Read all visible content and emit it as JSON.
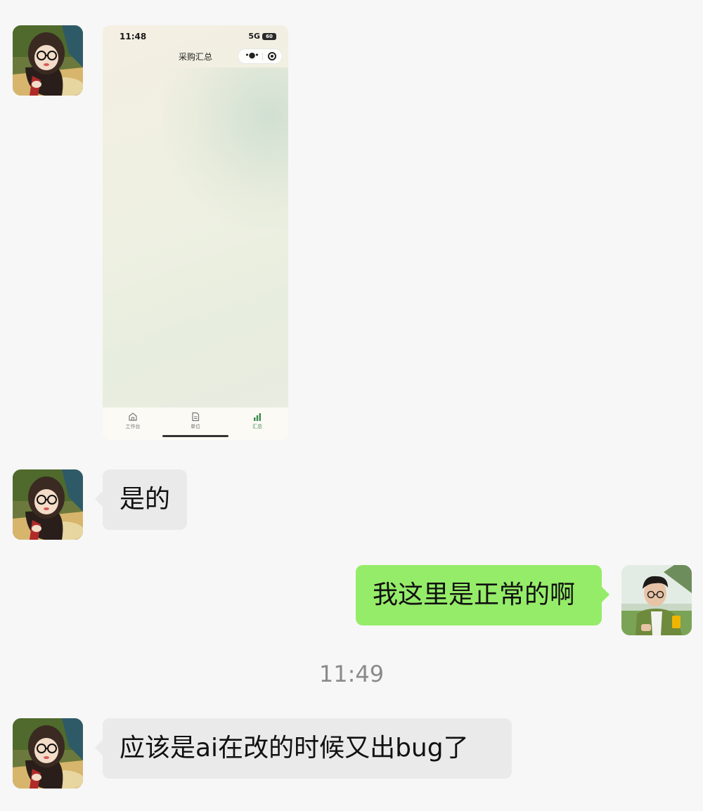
{
  "screenshot": {
    "status_time": "11:48",
    "network": "5G",
    "battery": "60",
    "nav_title": "采购汇总",
    "tabs": [
      {
        "label": "工作台",
        "icon": "home-icon",
        "active": false
      },
      {
        "label": "单位",
        "icon": "document-icon",
        "active": false
      },
      {
        "label": "汇总",
        "icon": "bar-chart-icon",
        "active": true
      }
    ],
    "colors": {
      "active_tab": "#3d8a4e"
    }
  },
  "messages": [
    {
      "sender": "other",
      "text": "是的"
    },
    {
      "sender": "self",
      "text": "我这里是正常的啊"
    },
    {
      "sender": "other",
      "text": "应该是ai在改的时候又出bug了"
    }
  ],
  "timestamp": "11:49",
  "colors": {
    "self_bubble": "#95ec69",
    "other_bubble": "#eaeaea",
    "background": "#f7f7f7"
  }
}
